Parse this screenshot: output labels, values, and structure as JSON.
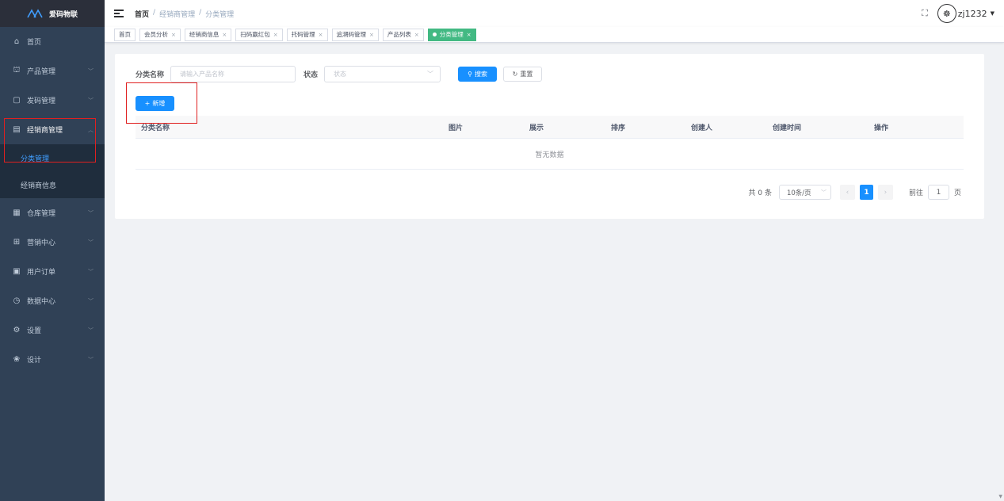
{
  "app": {
    "title": "爱码物联"
  },
  "sidebar": {
    "items": [
      {
        "label": "首页",
        "icon": "home-icon"
      },
      {
        "label": "产品管理",
        "icon": "product-icon"
      },
      {
        "label": "发码管理",
        "icon": "code-icon"
      },
      {
        "label": "经销商管理",
        "icon": "dealer-icon",
        "open": true,
        "children": [
          {
            "label": "分类管理",
            "active": true
          },
          {
            "label": "经销商信息"
          }
        ]
      },
      {
        "label": "仓库管理",
        "icon": "warehouse-icon"
      },
      {
        "label": "营销中心",
        "icon": "marketing-icon"
      },
      {
        "label": "用户订单",
        "icon": "order-icon"
      },
      {
        "label": "数据中心",
        "icon": "data-icon"
      },
      {
        "label": "设置",
        "icon": "settings-icon"
      },
      {
        "label": "设计",
        "icon": "design-icon"
      }
    ]
  },
  "header": {
    "breadcrumb": [
      "首页",
      "/",
      "经销商管理",
      "/",
      "分类管理"
    ],
    "username": "zj1232"
  },
  "tags": [
    {
      "label": "首页",
      "closable": false
    },
    {
      "label": "会员分析",
      "closable": true
    },
    {
      "label": "经销商信息",
      "closable": true
    },
    {
      "label": "扫码赢红包",
      "closable": true
    },
    {
      "label": "托码管理",
      "closable": true
    },
    {
      "label": "追溯码管理",
      "closable": true
    },
    {
      "label": "产品列表",
      "closable": true
    },
    {
      "label": "分类管理",
      "closable": true,
      "active": true
    }
  ],
  "search": {
    "name_label": "分类名称",
    "name_placeholder": "请输入产品名称",
    "status_label": "状态",
    "status_placeholder": "状态",
    "search_button": "搜索",
    "reset_button": "重置"
  },
  "toolbar": {
    "add_button": "新增"
  },
  "table": {
    "columns": [
      "分类名称",
      "图片",
      "展示",
      "排序",
      "创建人",
      "创建时间",
      "操作"
    ],
    "empty_text": "暂无数据"
  },
  "pagination": {
    "total_text": "共 0 条",
    "page_size": "10条/页",
    "current_page": "1",
    "goto_label": "前往",
    "goto_value": "1",
    "page_suffix": "页"
  },
  "colors": {
    "sidebar_bg": "#304156",
    "primary": "#1890ff",
    "active_tag": "#42b983",
    "highlight": "#e02020"
  }
}
